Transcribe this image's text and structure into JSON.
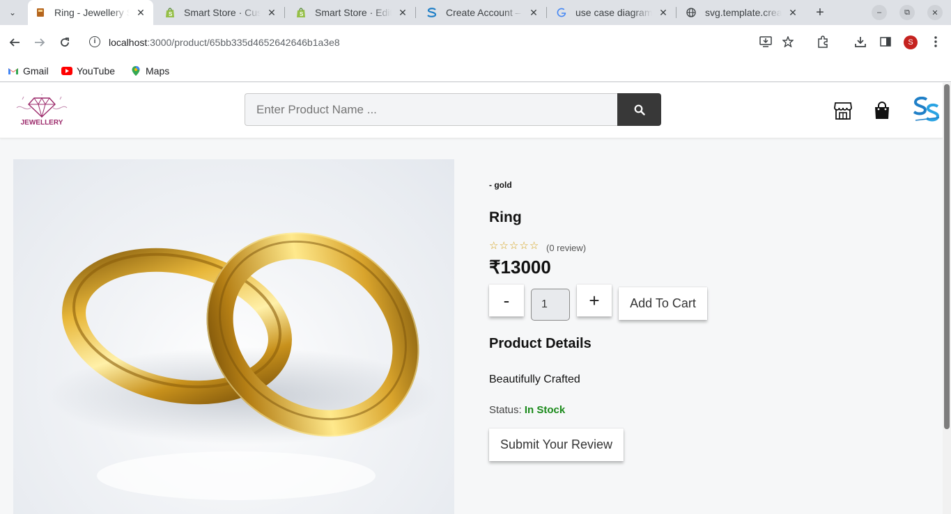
{
  "browser": {
    "tabs": [
      {
        "title": "Ring - Jewellery Store",
        "favicon": "jewellery-favicon",
        "active": true
      },
      {
        "title": "Smart Store · Customers",
        "favicon": "shopify-icon",
        "active": false
      },
      {
        "title": "Smart Store · Edit",
        "favicon": "shopify-icon",
        "active": false
      },
      {
        "title": "Create Account –",
        "favicon": "smart-store-icon",
        "active": false
      },
      {
        "title": "use case diagram",
        "favicon": "google-icon",
        "active": false
      },
      {
        "title": "svg.template.creator",
        "favicon": "globe-icon",
        "active": false
      }
    ],
    "url_host": "localhost",
    "url_path": ":3000/product/65bb335d4652642646b1a3e8",
    "profile_initial": "S",
    "bookmarks": [
      {
        "label": "Gmail",
        "icon": "gmail-icon"
      },
      {
        "label": "YouTube",
        "icon": "youtube-icon"
      },
      {
        "label": "Maps",
        "icon": "maps-icon"
      }
    ]
  },
  "header": {
    "logo_text": "JEWELLERY",
    "search_placeholder": "Enter Product Name ..."
  },
  "product": {
    "brand": "- gold",
    "name": "Ring",
    "rating": 0,
    "reviews": "(0 review)",
    "price": "₹13000",
    "qty_minus": "-",
    "qty_value": "1",
    "qty_plus": "+",
    "add_to_cart": "Add To Cart",
    "details_title": "Product Details",
    "description": "Beautifully Crafted",
    "status_label": "Status:",
    "status_value": "In Stock",
    "submit_review": "Submit Your Review"
  },
  "colors": {
    "in_stock": "#1a8a1a",
    "search_button": "#383838",
    "star": "#d4a017",
    "logo": "#9c2a6b"
  }
}
